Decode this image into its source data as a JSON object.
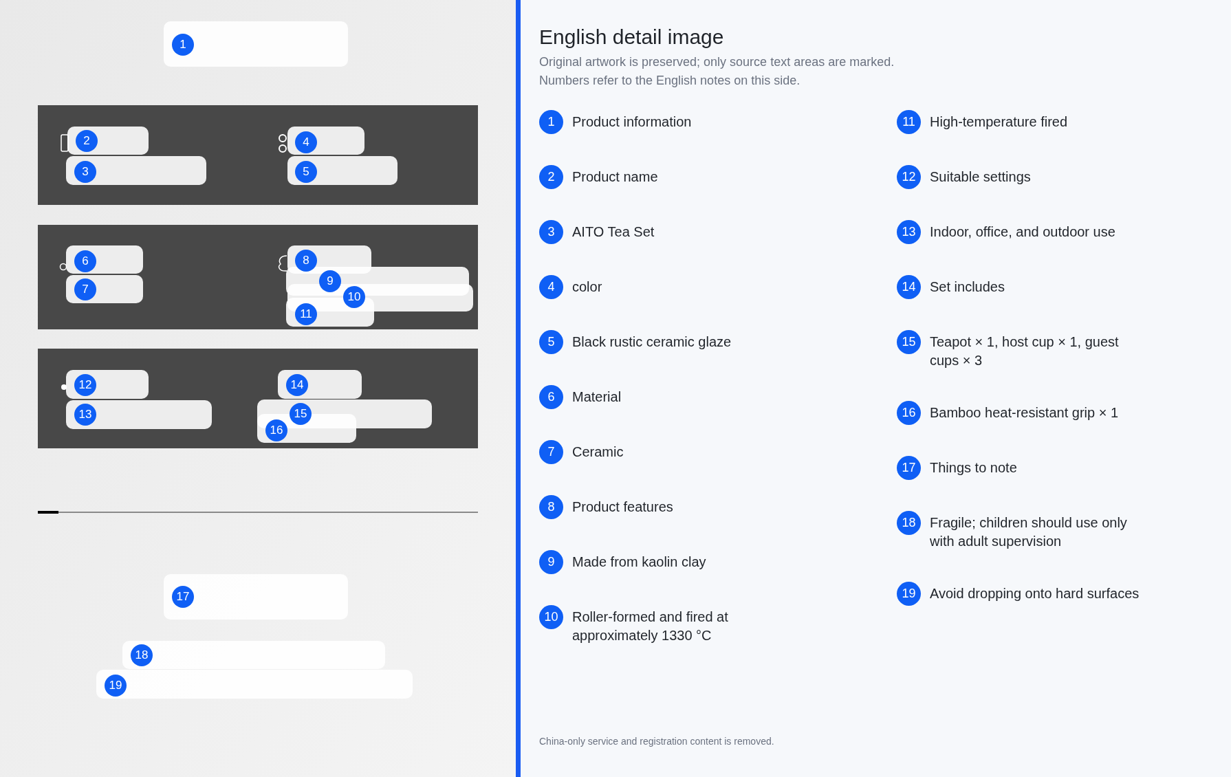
{
  "image_markers": [
    {
      "number": "1"
    },
    {
      "number": "2"
    },
    {
      "number": "3"
    },
    {
      "number": "4"
    },
    {
      "number": "5"
    },
    {
      "number": "6"
    },
    {
      "number": "7"
    },
    {
      "number": "8"
    },
    {
      "number": "9"
    },
    {
      "number": "10"
    },
    {
      "number": "11"
    },
    {
      "number": "12"
    },
    {
      "number": "13"
    },
    {
      "number": "14"
    },
    {
      "number": "15"
    },
    {
      "number": "16"
    },
    {
      "number": "17"
    },
    {
      "number": "18"
    },
    {
      "number": "19"
    }
  ],
  "title": "English detail image",
  "subtitle_lines": [
    "Original artwork is preserved; only source text areas are marked.",
    "Numbers refer to the English notes on this side."
  ],
  "notes": [
    {
      "number": "1",
      "text": "Product information"
    },
    {
      "number": "2",
      "text": "Product name"
    },
    {
      "number": "3",
      "text": "AITO Tea Set"
    },
    {
      "number": "4",
      "text": "color"
    },
    {
      "number": "5",
      "text": "Black rustic ceramic glaze"
    },
    {
      "number": "6",
      "text": "Material"
    },
    {
      "number": "7",
      "text": "Ceramic"
    },
    {
      "number": "8",
      "text": "Product features"
    },
    {
      "number": "9",
      "text": "Made from kaolin clay"
    },
    {
      "number": "10",
      "text": "Roller-formed and fired at approximately 1330 °C"
    },
    {
      "number": "11",
      "text": "High-temperature fired"
    },
    {
      "number": "12",
      "text": "Suitable settings"
    },
    {
      "number": "13",
      "text": "Indoor, office, and outdoor use"
    },
    {
      "number": "14",
      "text": "Set includes"
    },
    {
      "number": "15",
      "text": "Teapot × 1, host cup × 1, guest cups × 3"
    },
    {
      "number": "16",
      "text": "Bamboo heat-resistant grip × 1"
    },
    {
      "number": "17",
      "text": "Things to note"
    },
    {
      "number": "18",
      "text": "Fragile; children should use only with adult supervision"
    },
    {
      "number": "19",
      "text": "Avoid dropping onto hard surfaces"
    }
  ],
  "footer": "China-only service and registration content is removed."
}
